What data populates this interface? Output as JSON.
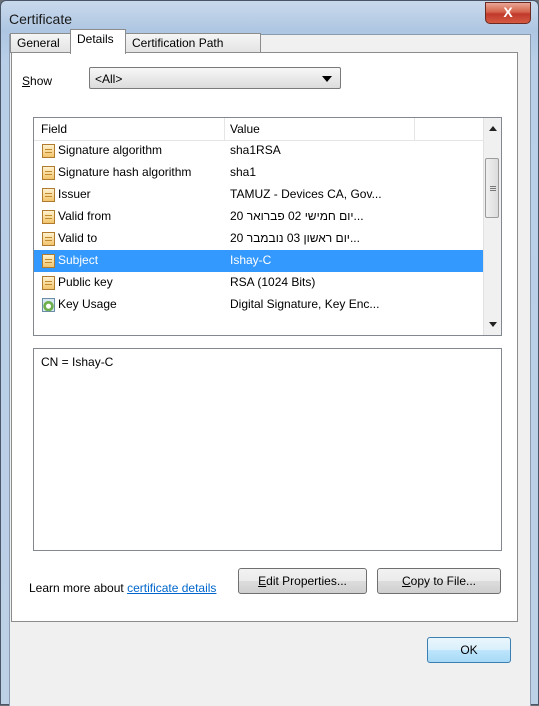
{
  "window": {
    "title": "Certificate",
    "close_label": "X"
  },
  "tabs": [
    {
      "label": "General",
      "active": false
    },
    {
      "label": "Details",
      "active": true
    },
    {
      "label": "Certification Path",
      "active": false
    }
  ],
  "show": {
    "label": "Show",
    "selected": "<All>"
  },
  "list": {
    "columns": [
      "Field",
      "Value"
    ],
    "rows": [
      {
        "field": "Signature algorithm",
        "value": "sha1RSA",
        "icon": "certificate-field-icon",
        "selected": false
      },
      {
        "field": "Signature hash algorithm",
        "value": "sha1",
        "icon": "certificate-field-icon",
        "selected": false
      },
      {
        "field": "Issuer",
        "value": "TAMUZ - Devices CA, Gov...",
        "icon": "certificate-field-icon",
        "selected": false
      },
      {
        "field": "Valid from",
        "value": "יום חמישי 02 פברואר 20...",
        "icon": "certificate-field-icon",
        "selected": false
      },
      {
        "field": "Valid to",
        "value": "יום ראשון 03 נובמבר 20...",
        "icon": "certificate-field-icon",
        "selected": false
      },
      {
        "field": "Subject",
        "value": "Ishay-C",
        "icon": "certificate-field-icon",
        "selected": true
      },
      {
        "field": "Public key",
        "value": "RSA (1024 Bits)",
        "icon": "certificate-field-icon",
        "selected": false
      },
      {
        "field": "Key Usage",
        "value": "Digital Signature, Key Enc...",
        "icon": "key-usage-icon",
        "selected": false
      }
    ]
  },
  "detail": {
    "text": "CN = Ishay-C"
  },
  "buttons": {
    "edit_properties": "Edit Properties...",
    "copy_to_file": "Copy to File...",
    "ok": "OK"
  },
  "learn": {
    "prefix": "Learn more about ",
    "link": "certificate details"
  },
  "colors": {
    "selection": "#3399ff",
    "link": "#0066cc",
    "close": "#c0392b"
  }
}
